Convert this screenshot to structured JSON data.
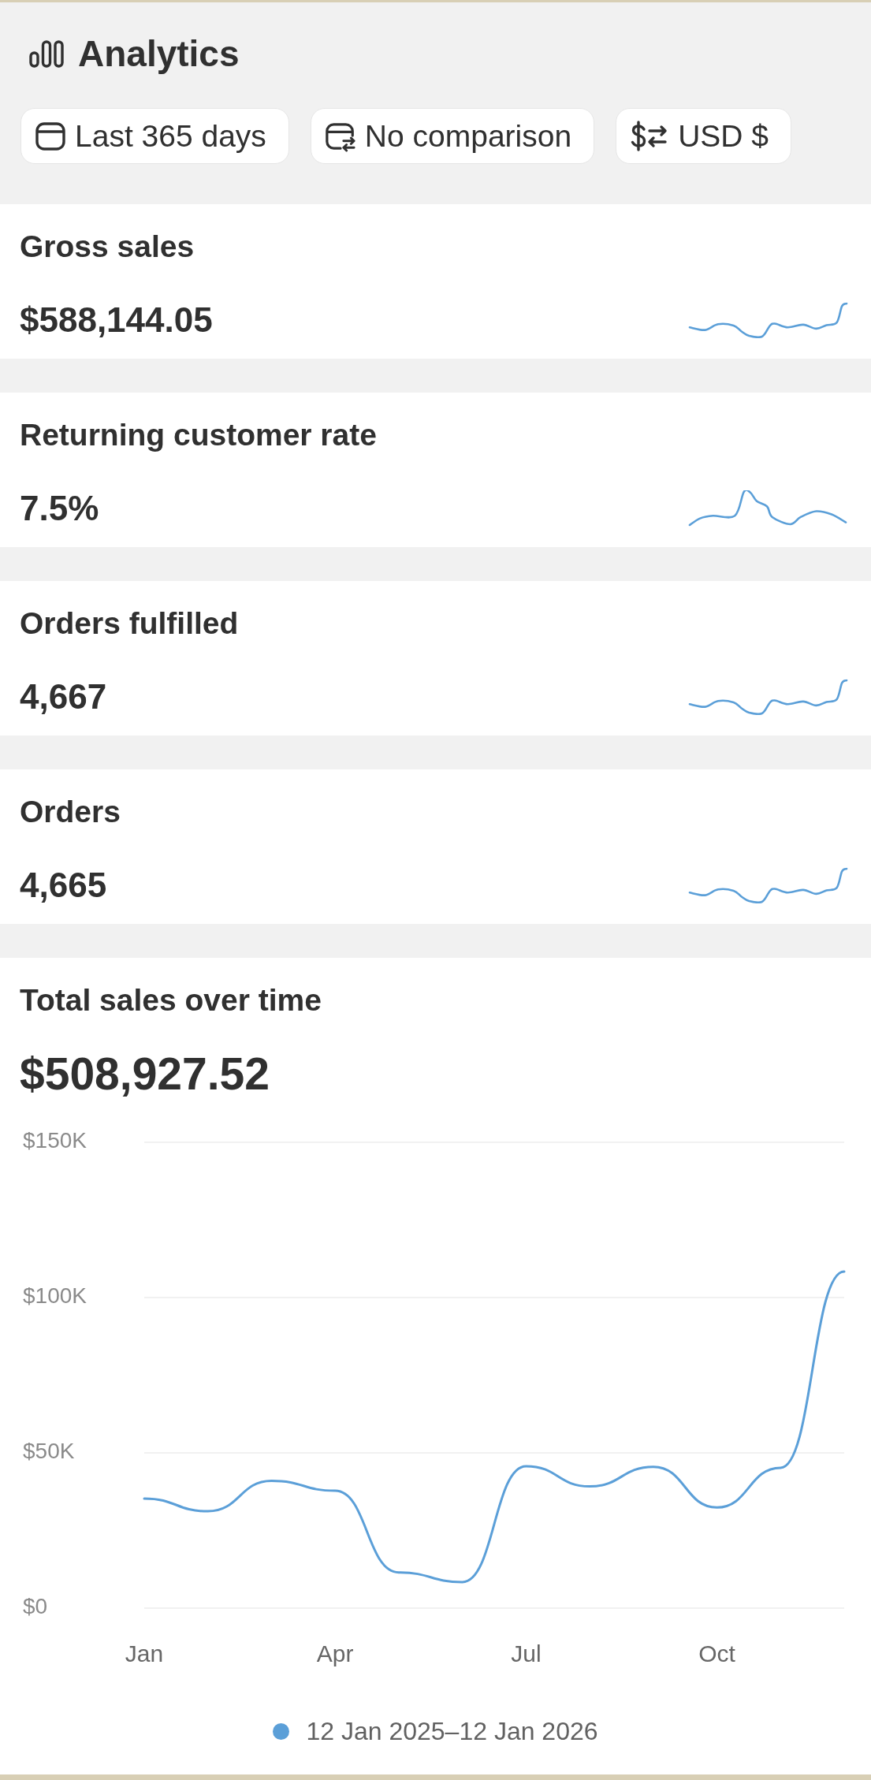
{
  "header": {
    "title": "Analytics",
    "filters": [
      {
        "kind": "date_range",
        "label": "Last 365 days"
      },
      {
        "kind": "comparison",
        "label": "No comparison"
      },
      {
        "kind": "currency",
        "label": "USD $"
      }
    ]
  },
  "metrics": [
    {
      "label": "Gross sales",
      "value": "$588,144.05"
    },
    {
      "label": "Returning customer rate",
      "value": "7.5%"
    },
    {
      "label": "Orders fulfilled",
      "value": "4,667"
    },
    {
      "label": "Orders",
      "value": "4,665"
    }
  ],
  "total_sales": {
    "title": "Total sales over time",
    "value": "$508,927.52",
    "chart_data": {
      "type": "line",
      "categories": [
        "Jan",
        null,
        null,
        "Apr",
        null,
        null,
        "Jul",
        null,
        null,
        "Oct",
        null,
        null
      ],
      "ylim": [
        0,
        150000
      ],
      "yticks": [
        {
          "value": 0,
          "label": "$0"
        },
        {
          "value": 50000,
          "label": "$50K"
        },
        {
          "value": 100000,
          "label": "$100K"
        },
        {
          "value": 150000,
          "label": "$150K"
        }
      ],
      "series": [
        {
          "name": "12 Jan 2025–12 Jan 2026",
          "color": "#5b9fd8",
          "values": [
            35300,
            31200,
            41000,
            37800,
            11500,
            8400,
            45700,
            39200,
            45500,
            32400,
            45200,
            108400
          ]
        }
      ]
    }
  }
}
